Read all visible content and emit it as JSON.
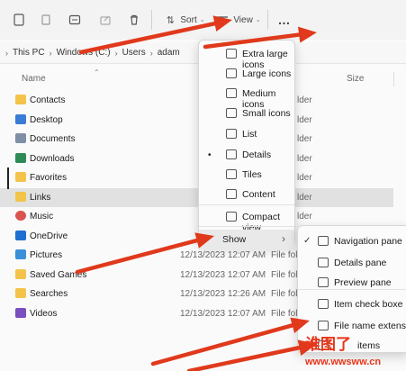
{
  "toolbar": {
    "sort_label": "Sort",
    "view_label": "View",
    "more_label": "…"
  },
  "address": [
    "This PC",
    "Windows (C:)",
    "Users",
    "adam"
  ],
  "list": {
    "col_name": "Name",
    "col_size": "Size",
    "rows": [
      {
        "name": "Contacts",
        "date": "",
        "type": "",
        "tail": "lder",
        "icon": "contacts-icon"
      },
      {
        "name": "Desktop",
        "date": "",
        "type": "",
        "tail": "lder",
        "icon": "desktop-icon"
      },
      {
        "name": "Documents",
        "date": "",
        "type": "",
        "tail": "lder",
        "icon": "documents-icon"
      },
      {
        "name": "Downloads",
        "date": "",
        "type": "",
        "tail": "lder",
        "icon": "downloads-icon"
      },
      {
        "name": "Favorites",
        "date": "",
        "type": "",
        "tail": "lder",
        "icon": "favorites-icon"
      },
      {
        "name": "Links",
        "date": "",
        "type": "",
        "tail": "lder",
        "icon": "links-icon",
        "selected": true
      },
      {
        "name": "Music",
        "date": "",
        "type": "",
        "tail": "lder",
        "icon": "music-icon"
      },
      {
        "name": "OneDrive",
        "date": "",
        "type": "",
        "tail": "lder",
        "icon": "onedrive-icon"
      },
      {
        "name": "Pictures",
        "date": "12/13/2023 12:07 AM",
        "type": "File fol",
        "tail": "",
        "icon": "pictures-icon"
      },
      {
        "name": "Saved Games",
        "date": "12/13/2023 12:07 AM",
        "type": "File fol",
        "tail": "",
        "icon": "saved-games-icon"
      },
      {
        "name": "Searches",
        "date": "12/13/2023 12:26 AM",
        "type": "File fol",
        "tail": "",
        "icon": "searches-icon"
      },
      {
        "name": "Videos",
        "date": "12/13/2023 12:07 AM",
        "type": "File fol",
        "tail": "",
        "icon": "videos-icon"
      }
    ]
  },
  "view_menu": {
    "items": [
      {
        "label": "Extra large icons",
        "icon": "extra-large-icons-icon"
      },
      {
        "label": "Large icons",
        "icon": "large-icons-icon"
      },
      {
        "label": "Medium icons",
        "icon": "medium-icons-icon"
      },
      {
        "label": "Small icons",
        "icon": "small-icons-icon"
      },
      {
        "label": "List",
        "icon": "list-icon"
      },
      {
        "label": "Details",
        "icon": "details-icon",
        "selected": true
      },
      {
        "label": "Tiles",
        "icon": "tiles-icon"
      },
      {
        "label": "Content",
        "icon": "content-icon"
      },
      {
        "label": "Compact view",
        "icon": "compact-view-icon"
      },
      {
        "label": "Show",
        "icon": "",
        "submenu": true
      }
    ]
  },
  "show_menu": {
    "items": [
      {
        "label": "Navigation pane",
        "checked": true,
        "icon": "navigation-pane-icon"
      },
      {
        "label": "Details pane",
        "icon": "details-pane-icon"
      },
      {
        "label": "Preview pane",
        "icon": "preview-pane-icon"
      },
      {
        "label": "Item check boxe",
        "icon": "item-check-boxes-icon"
      },
      {
        "label": "File name extens",
        "icon": "file-name-extensions-icon"
      },
      {
        "label": "items",
        "icon": "hidden-items-icon"
      }
    ]
  },
  "watermark": {
    "cn": "谁图了",
    "url": "www.wwsww.cn"
  },
  "colors": {
    "arrow": "#e0391c",
    "folder": "#f3c34a",
    "accent": "#0067c0"
  }
}
